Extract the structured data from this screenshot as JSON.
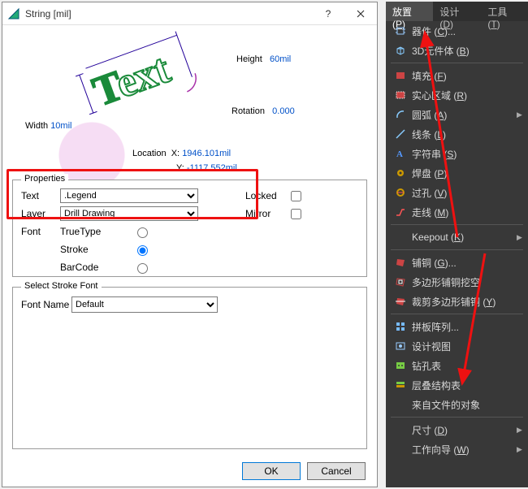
{
  "dialog": {
    "title": "String  [mil]",
    "preview": {
      "width_label": "Width",
      "width_value": "10mil",
      "height_label": "Height",
      "height_value": "60mil",
      "rotation_label": "Rotation",
      "rotation_value": "0.000",
      "location_label": "Location",
      "xy_x_label": "X:",
      "xy_x_value": "1946.101mil",
      "xy_y_label": "Y:",
      "xy_y_value": "-1117.552mil",
      "sample_text": "Text"
    },
    "properties": {
      "legend": "Properties",
      "text_label": "Text",
      "text_value": ".Legend",
      "layer_label": "Layer",
      "layer_value": "Drill Drawing",
      "font_label": "Font",
      "font_truetype": "TrueType",
      "font_stroke": "Stroke",
      "font_barcode": "BarCode",
      "locked_label": "Locked",
      "mirror_label": "Mirror"
    },
    "stroke": {
      "legend": "Select Stroke Font",
      "fontname_label": "Font Name",
      "fontname_value": "Default"
    },
    "buttons": {
      "ok": "OK",
      "cancel": "Cancel"
    }
  },
  "menu": {
    "tabs": {
      "place": "放置",
      "place_key": "P",
      "design": "设计",
      "design_key": "D",
      "tool": "工具",
      "tool_key": "T"
    },
    "items": [
      {
        "icon": "chip",
        "label": "器件 (C)...",
        "sub": false
      },
      {
        "icon": "cube",
        "label": "3D元件体 (B)",
        "sub": false
      },
      {
        "sep": true
      },
      {
        "icon": "rect",
        "label": "填充 (F)",
        "sub": false
      },
      {
        "icon": "solid",
        "label": "实心区域 (R)",
        "sub": false
      },
      {
        "icon": "arc",
        "label": "圆弧 (A)",
        "sub": true
      },
      {
        "icon": "line",
        "label": "线条 (L)",
        "sub": false
      },
      {
        "icon": "string",
        "label": "字符串 (S)",
        "sub": false
      },
      {
        "icon": "pad",
        "label": "焊盘 (P)",
        "sub": false
      },
      {
        "icon": "via",
        "label": "过孔 (V)",
        "sub": false
      },
      {
        "icon": "route",
        "label": "走线 (M)",
        "sub": false
      },
      {
        "sep": true
      },
      {
        "icon": "",
        "label": "Keepout (K)",
        "sub": true
      },
      {
        "sep": true
      },
      {
        "icon": "poly",
        "label": "铺铜 (G)...",
        "sub": false
      },
      {
        "icon": "polycut",
        "label": "多边形铺铜挖空",
        "sub": false
      },
      {
        "icon": "polyclip",
        "label": "裁剪多边形铺铜 (Y)",
        "sub": false
      },
      {
        "sep": true
      },
      {
        "icon": "grid",
        "label": "拼板阵列...",
        "sub": false
      },
      {
        "icon": "view",
        "label": "设计视图",
        "sub": false
      },
      {
        "icon": "drill",
        "label": "钻孔表",
        "sub": false
      },
      {
        "icon": "stack",
        "label": "层叠结构表",
        "sub": false
      },
      {
        "icon": "",
        "label": "来自文件的对象",
        "sub": false
      },
      {
        "sep": true
      },
      {
        "icon": "",
        "label": "尺寸 (D)",
        "sub": true
      },
      {
        "icon": "",
        "label": "工作向导 (W)",
        "sub": true
      }
    ]
  }
}
